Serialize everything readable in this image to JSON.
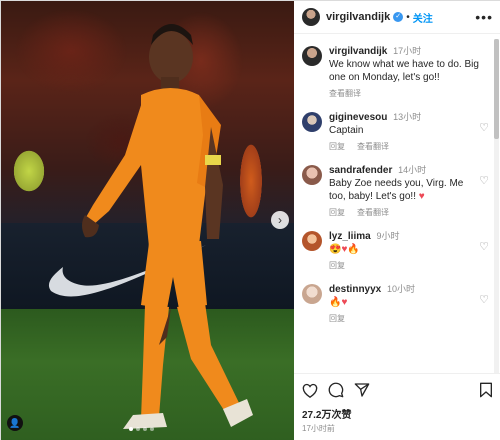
{
  "header": {
    "username": "virgilvandijk",
    "verified_mark": "✓",
    "separator": "•",
    "follow_label": "关注",
    "more_label": "•••"
  },
  "caption": {
    "username": "virgilvandijk",
    "time": "17小时",
    "text": "We know what we have to do. Big one on Monday, let's go!!",
    "translate_label": "查看翻译"
  },
  "comments": [
    {
      "username": "giginevesou",
      "time": "13小时",
      "text": "Captain",
      "reply_label": "回复",
      "translate_label": "查看翻译"
    },
    {
      "username": "sandrafender",
      "time": "14小时",
      "text": "Baby Zoe needs you, Virg. Me too, baby! Let's go!!",
      "emoji": "♥",
      "reply_label": "回复",
      "translate_label": "查看翻译"
    },
    {
      "username": "lyz_liima",
      "time": "9小时",
      "emoji": "😍♥🔥",
      "reply_label": "回复"
    },
    {
      "username": "destinnyyx",
      "time": "10小时",
      "emoji": "🔥♥",
      "reply_label": "回复"
    }
  ],
  "footer": {
    "likes": "27.2万次赞",
    "posted": "17小时前"
  },
  "photo": {
    "next_arrow": "›",
    "tag_icon": "person-tag-icon",
    "tag_glyph": "👤"
  },
  "colors": {
    "accent": "#0095f6",
    "verified": "#3897f0",
    "heart_red": "#ed4956"
  }
}
